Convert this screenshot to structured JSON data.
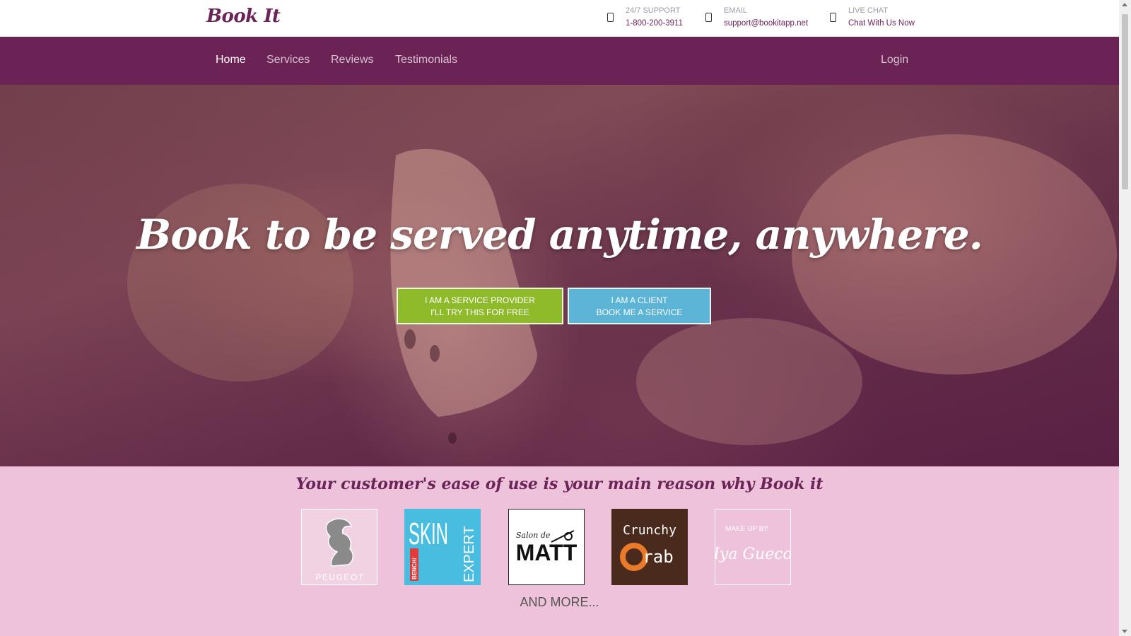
{
  "header": {
    "logo": "Book It",
    "contacts": [
      {
        "icon": "phone-icon",
        "label": "24/7 SUPPORT",
        "value": "1-800-200-3911"
      },
      {
        "icon": "email-icon",
        "label": "EMAIL",
        "value": "support@bookitapp.net"
      },
      {
        "icon": "chat-icon",
        "label": "LIVE CHAT",
        "value": "Chat With Us Now"
      }
    ]
  },
  "nav": {
    "items": [
      {
        "label": "Home",
        "active": true
      },
      {
        "label": "Services",
        "active": false
      },
      {
        "label": "Reviews",
        "active": false
      },
      {
        "label": "Testimonials",
        "active": false
      }
    ],
    "login": "Login"
  },
  "hero": {
    "title": "Book to be served anytime, anywhere.",
    "provider_button": {
      "line1": "I AM A SERVICE PROVIDER",
      "line2": "I'LL TRY THIS FOR FREE"
    },
    "client_button": {
      "line1": "I AM A CLIENT",
      "line2": "BOOK ME A SERVICE"
    }
  },
  "clients": {
    "title": "Your customer's ease of use is your main reason why Book it",
    "brands": [
      {
        "name": "PEUGEOT"
      },
      {
        "name": "SKIN",
        "sub": "EXPERT",
        "tag": "BENCH/"
      },
      {
        "name": "MATT",
        "prefix": "Salon de"
      },
      {
        "name": "Crunchy",
        "sub": "rab"
      },
      {
        "name": "Iya Gueco",
        "prefix": "MAKE UP BY"
      }
    ],
    "more": "AND MORE..."
  },
  "colors": {
    "brand": "#6a2354",
    "provider": "#8fbb2a",
    "client": "#5cb4d6",
    "section_bg": "#eec2da"
  }
}
